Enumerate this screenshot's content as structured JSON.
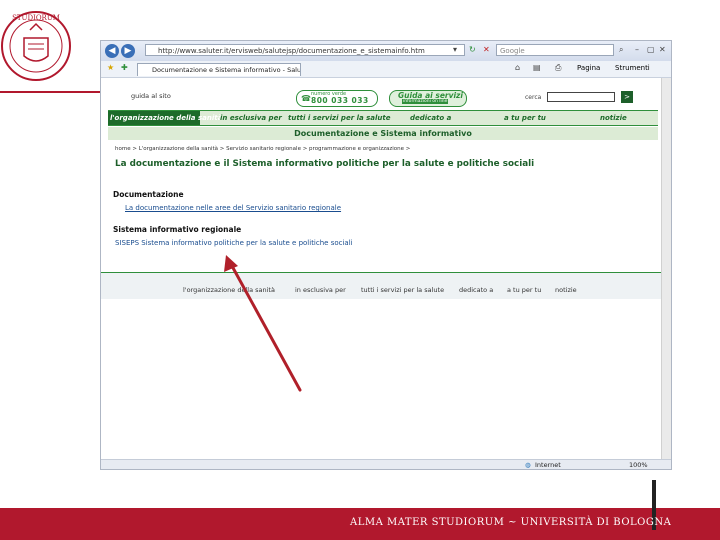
{
  "colors": {
    "brand_red": "#b1182d",
    "site_green": "#1d6b2a",
    "arrow": "#b0202a"
  },
  "slide": {
    "footer_text": "ALMA MATER STUDIORUM ~ UNIVERSITÀ DI BOLOGNA"
  },
  "browser": {
    "url": "http://www.saluter.it/ervisweb/salutejsp/documentazione_e_sistemainfo.htm",
    "search_placeholder": "Google",
    "tab_title": "Documentazione e Sistema informativo - Saluter",
    "toolbar": {
      "page_label": "Pagina",
      "tools_label": "Strumenti"
    },
    "status": {
      "zone": "Internet",
      "zoom": "100%"
    }
  },
  "site": {
    "guide_label": "guida al sito",
    "numero_verde_label": "numero verde",
    "numero_verde_number": "800 033 033",
    "guida_servizi_title": "Guida ai servizi",
    "guida_servizi_sub": "informazioni on line",
    "search_label": "cerca",
    "search_go": ">",
    "menu": [
      "l'organizzazione della sanità",
      "in esclusiva per",
      "tutti i servizi per la salute",
      "dedicato a",
      "a tu per tu",
      "notizie"
    ],
    "section_title": "Documentazione e Sistema informativo",
    "breadcrumb": "home > L'organizzazione della sanità > Servizio sanitario regionale > programmazione e organizzazione >",
    "page_title": "La documentazione e il Sistema informativo politiche per la salute e politiche sociali",
    "doc_heading": "Documentazione",
    "doc_link": "La documentazione nelle aree del Servizio sanitario regionale",
    "sis_heading": "Sistema informativo regionale",
    "sis_link": "SISEPS Sistema informativo politiche per la salute e politiche sociali",
    "footer_links": [
      "l'organizzazione della sanità",
      "in esclusiva per",
      "tutti i servizi per la salute",
      "dedicato a",
      "a tu per tu",
      "notizie"
    ]
  }
}
